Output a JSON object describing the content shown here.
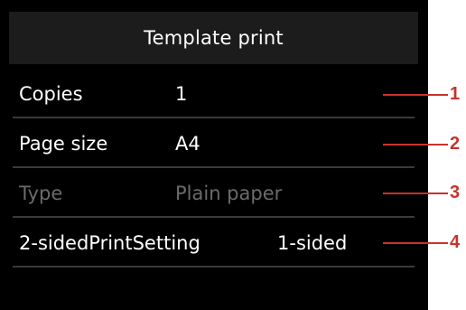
{
  "title": "Template print",
  "settings": [
    {
      "label": "Copies",
      "value": "1",
      "enabled": true
    },
    {
      "label": "Page size",
      "value": "A4",
      "enabled": true
    },
    {
      "label": "Type",
      "value": "Plain paper",
      "enabled": false
    },
    {
      "label": "2-sidedPrintSetting",
      "value": "1-sided",
      "enabled": true
    }
  ],
  "callouts": [
    "1",
    "2",
    "3",
    "4"
  ],
  "colors": {
    "background": "#000000",
    "title_bar": "#1c1c1c",
    "text": "#ffffff",
    "disabled_text": "#6b6b6b",
    "callout": "#c8332b"
  }
}
